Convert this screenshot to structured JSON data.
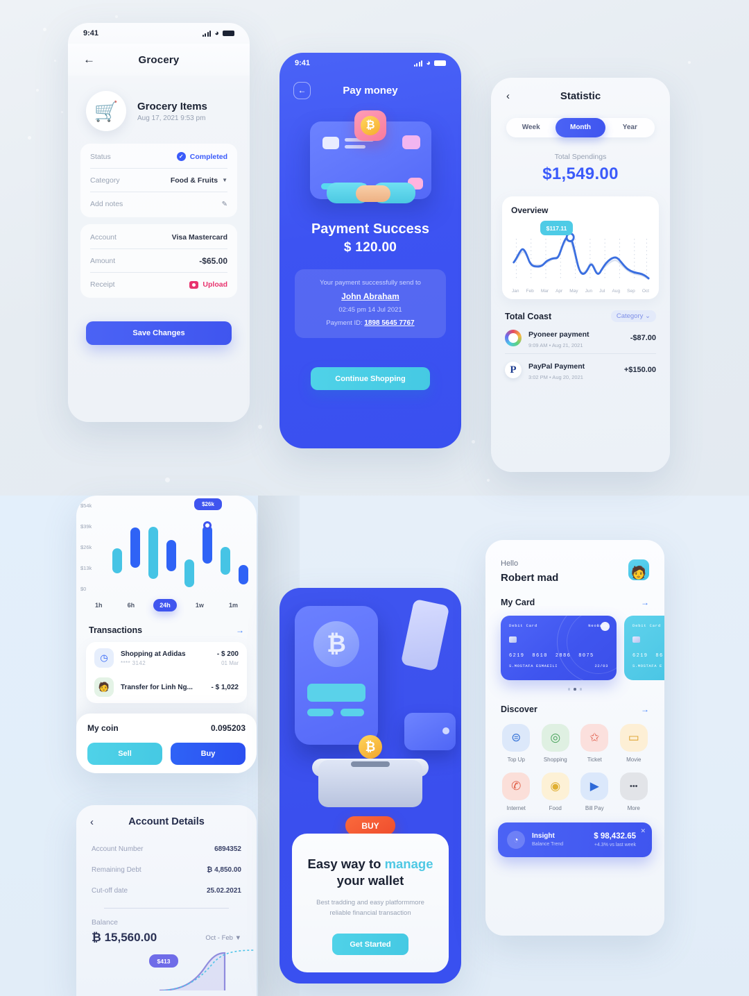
{
  "grocery": {
    "status_time": "9:41",
    "nav_title": "Grocery",
    "back_icon": "←",
    "item_title": "Grocery Items",
    "item_date": "Aug 17, 2021 9:53 pm",
    "cart_icon": "🛒",
    "rows_a": [
      {
        "label": "Status",
        "value": "Completed",
        "type": "status"
      },
      {
        "label": "Category",
        "value": "Food & Fruits",
        "type": "select"
      },
      {
        "label": "Add notes",
        "value": "",
        "type": "note"
      }
    ],
    "rows_b": [
      {
        "label": "Account",
        "value": "Visa Mastercard"
      },
      {
        "label": "Amount",
        "value": "-$65.00"
      },
      {
        "label": "Receipt",
        "value": "Upload",
        "type": "upload"
      }
    ],
    "save_label": "Save Changes"
  },
  "pay": {
    "status_time": "9:41",
    "nav_title": "Pay money",
    "back_icon": "←",
    "heading": "Payment Success",
    "amount": "$ 120.00",
    "receipt_line": "Your payment successfully send to",
    "receiver": "John Abraham",
    "timestamp": "02:45 pm  14 Jul 2021",
    "payment_id_label": "Payment ID:",
    "payment_id": "1898 5645 7767",
    "cta": "Continue Shopping",
    "bitcoin_glyph": "₿"
  },
  "statistic": {
    "nav_title": "Statistic",
    "back_icon": "‹",
    "segments": [
      {
        "label": "Week",
        "active": false
      },
      {
        "label": "Month",
        "active": true
      },
      {
        "label": "Year",
        "active": false
      }
    ],
    "total_label": "Total Spendings",
    "total_value": "$1,549.00",
    "overview_title": "Overview",
    "tooltip": "$117.11",
    "cost_title": "Total Coast",
    "cost_filter": "Category",
    "transactions": [
      {
        "name": "Pyoneer payment",
        "meta": "9:09 AM  •  Aug 21, 2021",
        "amount": "-$87.00",
        "icon": "ring"
      },
      {
        "name": "PayPal Payment",
        "meta": "3:02 PM  •  Aug 20, 2021",
        "amount": "+$150.00",
        "icon": "paypal"
      }
    ],
    "chart_data": {
      "type": "line",
      "title": "Overview",
      "x": [
        "Jan",
        "Feb",
        "Mar",
        "Apr",
        "May",
        "Jun",
        "Jul",
        "Aug",
        "Sep",
        "Oct"
      ],
      "values": [
        48,
        66,
        40,
        44,
        56,
        96,
        44,
        36,
        48,
        34,
        46,
        52,
        44,
        34,
        26,
        22
      ],
      "highlight": {
        "x": "Apr",
        "label": "$117.11",
        "value": 96
      },
      "xlabel": "",
      "ylabel": "",
      "grid": "dotted-vertical",
      "line_color": "#3b6fe0"
    }
  },
  "crypto": {
    "ylabels": [
      "$54k",
      "$39k",
      "$26k",
      "$13k",
      "$0"
    ],
    "ranges": [
      {
        "label": "1h",
        "active": false
      },
      {
        "label": "6h",
        "active": false
      },
      {
        "label": "24h",
        "active": true
      },
      {
        "label": "1w",
        "active": false
      },
      {
        "label": "1m",
        "active": false
      }
    ],
    "tooltip": "$26k",
    "transactions_title": "Transactions",
    "arrow_icon": "→",
    "rows": [
      {
        "name": "Shopping at Adidas",
        "sub": "**** 3142",
        "amount": "- $ 200",
        "date": "01 Mar",
        "icon": "clock"
      },
      {
        "name": "Transfer for Linh Ng...",
        "sub": "",
        "amount": "- $ 1,022",
        "date": "",
        "icon": "avatar"
      }
    ],
    "coin_label": "My coin",
    "coin_value": "0.095203",
    "sell_label": "Sell",
    "buy_label": "Buy",
    "chart_data": {
      "type": "bar",
      "subtype": "floating-range-bars",
      "ylabels": [
        "$0",
        "$13k",
        "$26k",
        "$39k",
        "$54k"
      ],
      "ymax": 54,
      "bars": [
        {
          "low": 12,
          "high": 27,
          "color": "#46c4e5"
        },
        {
          "low": 15,
          "high": 39,
          "color": "#2f63f6"
        },
        {
          "low": 7,
          "high": 39,
          "color": "#46c4e5"
        },
        {
          "low": 13,
          "high": 31,
          "color": "#2f63f6"
        },
        {
          "low": 5,
          "high": 21,
          "color": "#46c4e5"
        },
        {
          "low": 17,
          "high": 40,
          "color": "#2f63f6",
          "highlight": true,
          "label": "$26k"
        },
        {
          "low": 11,
          "high": 27,
          "color": "#46c4e5"
        },
        {
          "low": 8,
          "high": 17,
          "color": "#2f63f6"
        }
      ]
    }
  },
  "account": {
    "nav_title": "Account Details",
    "back_icon": "‹",
    "rows": [
      {
        "label": "Account Number",
        "value": "6894352"
      },
      {
        "label": "Remaining Debt",
        "value": "₿ 4,850.00"
      },
      {
        "label": "Cut-off date",
        "value": "25.02.2021"
      }
    ],
    "balance_label": "Balance",
    "balance_value": "₿ 15,560.00",
    "period": "Oct - Feb",
    "chart_tooltip": "$413"
  },
  "onboarding": {
    "headline_a": "Easy way to ",
    "headline_accent": "manage",
    "headline_b": "your wallet",
    "paragraph": "Best tradding and easy platformmore reliable financial transaction",
    "cta": "Get Started",
    "buy_badge": "BUY",
    "bitcoin_glyph": "₿"
  },
  "home": {
    "hello": "Hello",
    "name": "Robert mad",
    "my_card_title": "My Card",
    "arrow_icon": "→",
    "cards": [
      {
        "type": "Debit  Card",
        "brand": "NeoBank",
        "number": [
          "6219",
          "8610",
          "2886",
          "8075"
        ],
        "holder": "S.MOSTAFA ESMAEILI",
        "expiry": "22/03",
        "theme": "blue"
      },
      {
        "type": "Debit  Card",
        "brand": "",
        "number": [
          "6219",
          "86"
        ],
        "holder": "S.MOSTAFA E",
        "expiry": "",
        "theme": "teal"
      }
    ],
    "discover_title": "Discover",
    "discover": [
      {
        "label": "Top Up",
        "icon": "topup-icon",
        "glyph": "⊜",
        "bg": "#dce8fa",
        "fg": "#3a76d8"
      },
      {
        "label": "Shopping",
        "icon": "shopping-icon",
        "glyph": "◎",
        "bg": "#dff0e2",
        "fg": "#4ca45e"
      },
      {
        "label": "Ticket",
        "icon": "ticket-icon",
        "glyph": "✩",
        "bg": "#fbe0dd",
        "fg": "#e05c4a"
      },
      {
        "label": "Movie",
        "icon": "movie-icon",
        "glyph": "▭",
        "bg": "#fdefd5",
        "fg": "#dda02a"
      },
      {
        "label": "Internet",
        "icon": "internet-icon",
        "glyph": "✆",
        "bg": "#fbdfd9",
        "fg": "#e06048"
      },
      {
        "label": "Food",
        "icon": "food-icon",
        "glyph": "◉",
        "bg": "#fdf1d6",
        "fg": "#e0af33"
      },
      {
        "label": "Bill Pay",
        "icon": "billpay-icon",
        "glyph": "▶",
        "bg": "#dbe8fb",
        "fg": "#2f6ad8"
      },
      {
        "label": "More",
        "icon": "more-icon",
        "glyph": "•••",
        "bg": "#e2e4e8",
        "fg": "#404654"
      }
    ],
    "insight": {
      "title": "Insight",
      "subtitle": "Balance Trend",
      "amount": "$ 98,432.65",
      "delta": "+4.3% vs last week",
      "close_icon": "✕",
      "chart_icon": "◔"
    }
  }
}
